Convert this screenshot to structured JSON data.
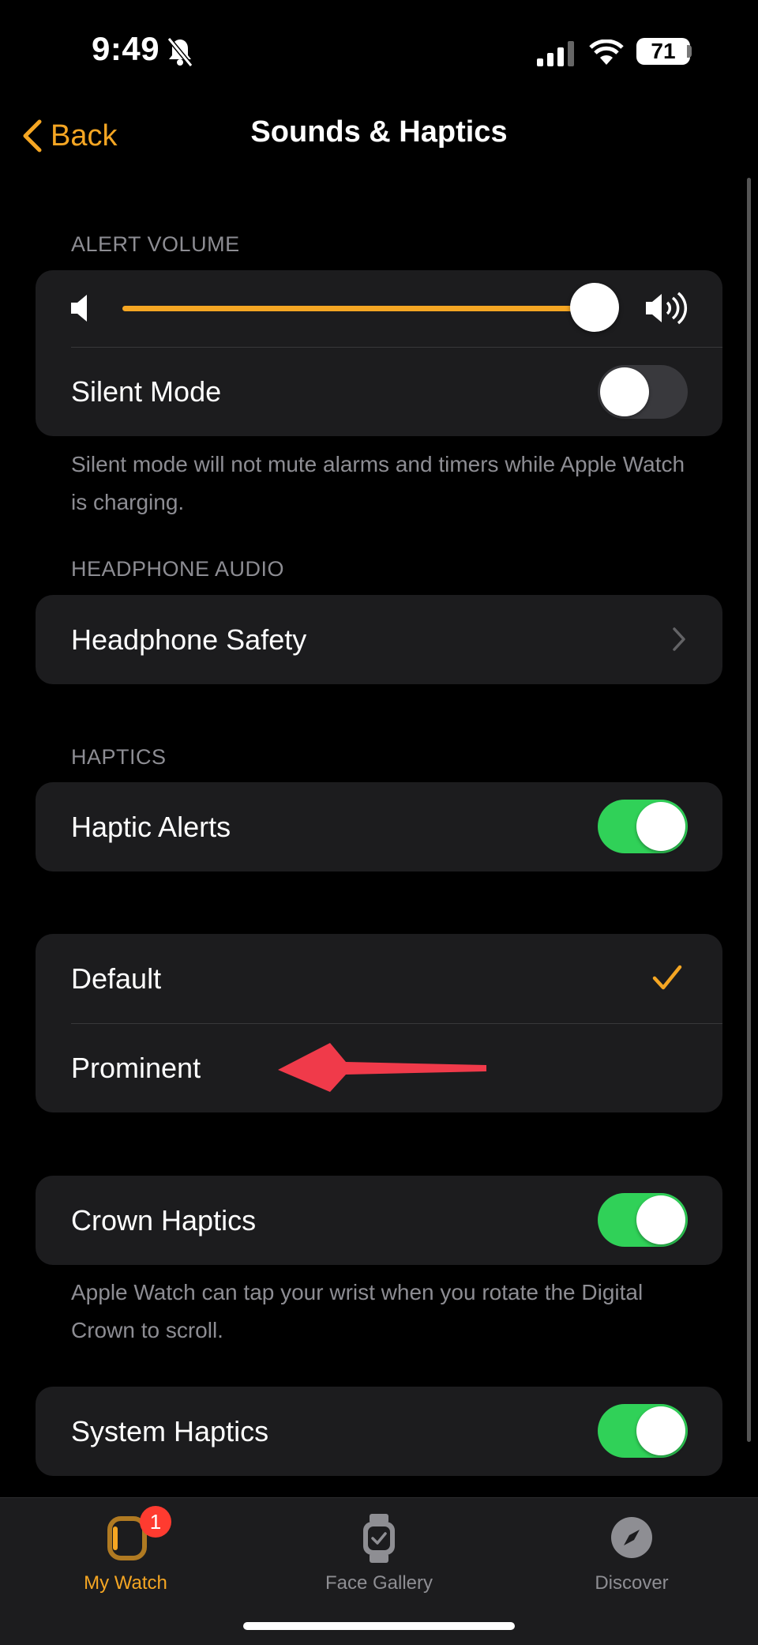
{
  "status_bar": {
    "time": "9:49",
    "battery": "71",
    "icons": [
      "bell-slash-icon",
      "cellular-signal-icon",
      "wifi-icon",
      "battery-icon"
    ]
  },
  "nav": {
    "back_label": "Back",
    "title": "Sounds & Haptics"
  },
  "alert_volume": {
    "header": "ALERT VOLUME",
    "level": 0.95,
    "silent_mode_label": "Silent Mode",
    "silent_mode_on": false,
    "footer": "Silent mode will not mute alarms and timers while Apple Watch is charging."
  },
  "headphone_audio": {
    "header": "HEADPHONE AUDIO",
    "safety_label": "Headphone Safety"
  },
  "haptics": {
    "header": "HAPTICS",
    "haptic_alerts_label": "Haptic Alerts",
    "haptic_alerts_on": true,
    "options": [
      {
        "label": "Default",
        "selected": true
      },
      {
        "label": "Prominent",
        "selected": false
      }
    ],
    "crown_label": "Crown Haptics",
    "crown_on": true,
    "crown_footer": "Apple Watch can tap your wrist when you rotate the Digital Crown to scroll.",
    "system_label": "System Haptics",
    "system_on": true
  },
  "tabbar": {
    "tabs": [
      {
        "label": "My Watch",
        "icon": "watch-icon",
        "active": true,
        "badge": "1"
      },
      {
        "label": "Face Gallery",
        "icon": "watch-face-icon",
        "active": false
      },
      {
        "label": "Discover",
        "icon": "compass-icon",
        "active": false
      }
    ]
  },
  "colors": {
    "accent": "#f5a623",
    "toggle_on": "#30d158",
    "annotation_arrow": "#f03a4a"
  }
}
